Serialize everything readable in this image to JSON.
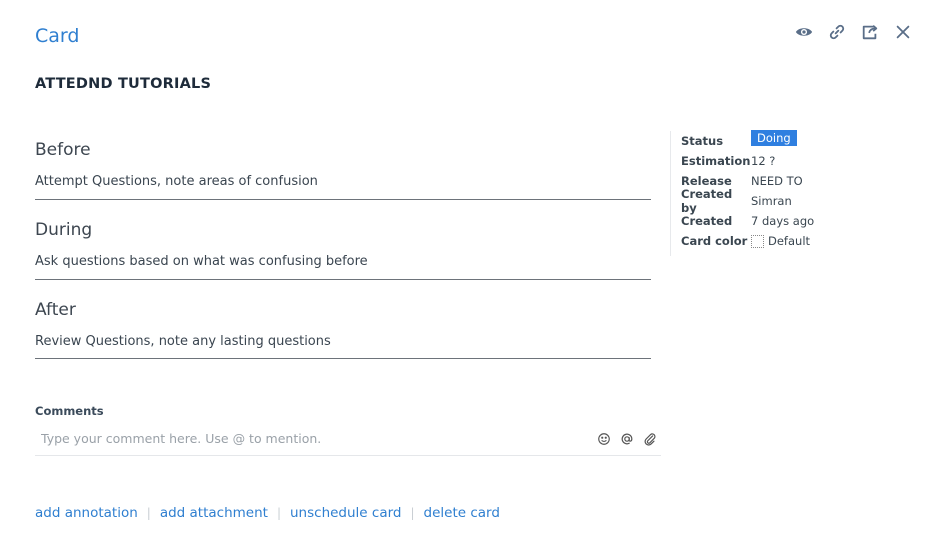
{
  "header": {
    "title": "Card"
  },
  "card": {
    "title": "ATTEDND TUTORIALS"
  },
  "sections": [
    {
      "heading": "Before",
      "text": "Attempt Questions, note areas of confusion"
    },
    {
      "heading": "During",
      "text": "Ask questions based on what was confusing before"
    },
    {
      "heading": "After",
      "text": "Review Questions, note any lasting questions"
    }
  ],
  "meta": {
    "status_label": "Status",
    "status_value": "Doing",
    "estimation_label": "Estimation",
    "estimation_value": "12 ?",
    "release_label": "Release",
    "release_value": "NEED TO",
    "created_by_label": "Created by",
    "created_by_value": "Simran",
    "created_label": "Created",
    "created_value": "7 days ago",
    "card_color_label": "Card color",
    "card_color_value": "Default"
  },
  "comments": {
    "label": "Comments",
    "placeholder": "Type your comment here. Use @ to mention."
  },
  "actions": {
    "add_annotation": "add annotation",
    "add_attachment": "add attachment",
    "unschedule_card": "unschedule card",
    "delete_card": "delete card",
    "separator": "|"
  },
  "icons": {
    "toolbar": [
      "eye-icon",
      "link-icon",
      "share-icon",
      "close-icon"
    ],
    "comment": [
      "smiley-icon",
      "at-icon",
      "paperclip-icon"
    ]
  },
  "colors": {
    "accent": "#2f7fd0",
    "status_badge": "#2f7fe0"
  }
}
